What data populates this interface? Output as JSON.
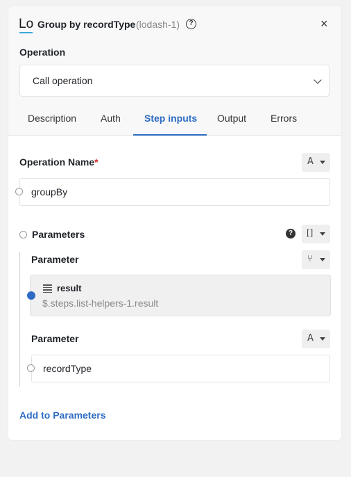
{
  "header": {
    "logo_text": "Lo",
    "title": "Group by recordType",
    "subtitle": "(lodash-1)",
    "help_glyph": "?",
    "close_glyph": "×"
  },
  "operation": {
    "label": "Operation",
    "selected": "Call operation"
  },
  "tabs": [
    {
      "label": "Description",
      "active": false
    },
    {
      "label": "Auth",
      "active": false
    },
    {
      "label": "Step inputs",
      "active": true
    },
    {
      "label": "Output",
      "active": false
    },
    {
      "label": "Errors",
      "active": false
    }
  ],
  "operation_name": {
    "label": "Operation Name",
    "required_mark": "*",
    "value": "groupBy",
    "type_glyph": "A"
  },
  "parameters": {
    "label": "Parameters",
    "help_glyph": "?",
    "type_glyph": "[]",
    "items": [
      {
        "label": "Parameter",
        "type_glyph": "⑂",
        "ref_title": "result",
        "ref_path": "$.steps.list-helpers-1.result"
      },
      {
        "label": "Parameter",
        "type_glyph": "A",
        "value": "recordType"
      }
    ],
    "add_label": "Add to Parameters"
  },
  "colors": {
    "accent": "#2d6bc4",
    "required": "#d32f2f",
    "logo_underline": "#3aa8d6"
  }
}
